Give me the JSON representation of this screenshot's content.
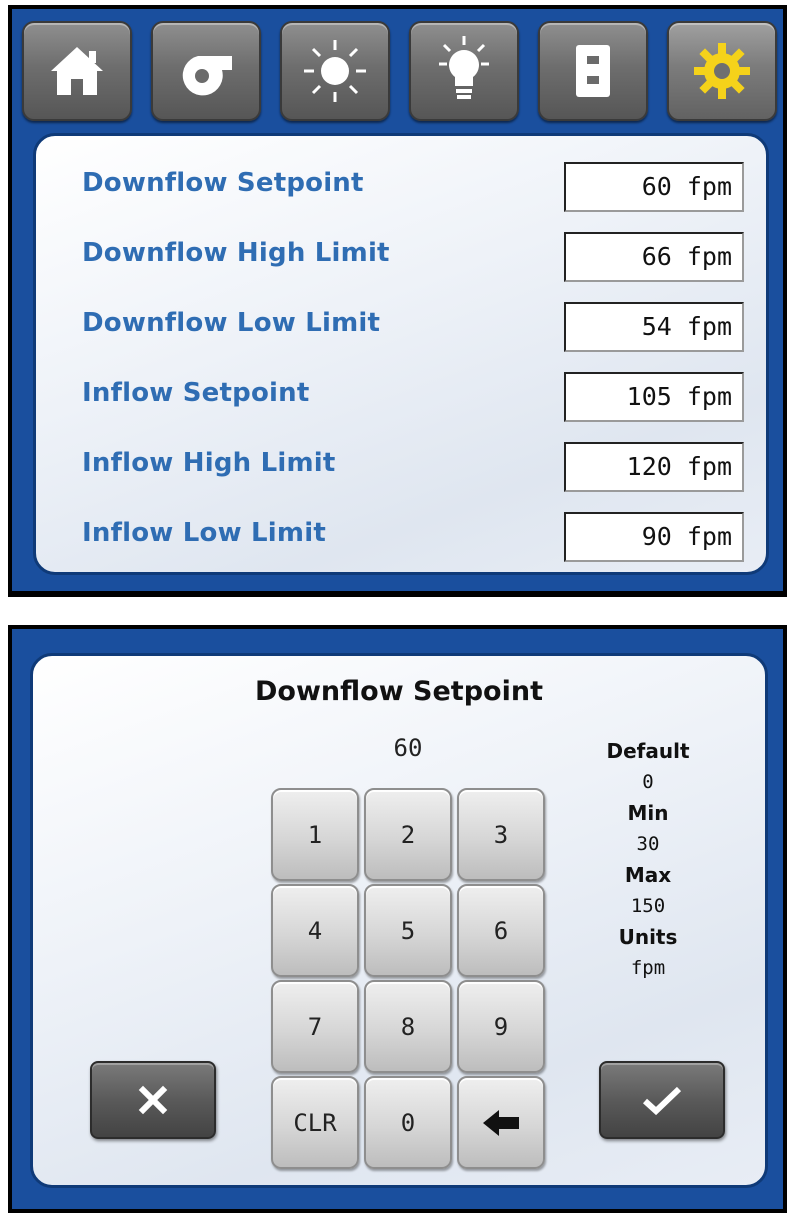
{
  "settings_screen": {
    "tabs": [
      {
        "icon": "home-icon",
        "active": false
      },
      {
        "icon": "fan-blower-icon",
        "active": false
      },
      {
        "icon": "sun-uv-icon",
        "active": false
      },
      {
        "icon": "light-bulb-icon",
        "active": false
      },
      {
        "icon": "outlet-icon",
        "active": false
      },
      {
        "icon": "gear-icon",
        "active": true
      }
    ],
    "rows": [
      {
        "label": "Downflow Setpoint",
        "value": "60 fpm"
      },
      {
        "label": "Downflow High Limit",
        "value": "66 fpm"
      },
      {
        "label": "Downflow Low Limit",
        "value": "54 fpm"
      },
      {
        "label": "Inflow Setpoint",
        "value": "105 fpm"
      },
      {
        "label": "Inflow High Limit",
        "value": "120 fpm"
      },
      {
        "label": "Inflow Low Limit",
        "value": "90 fpm"
      }
    ]
  },
  "keypad_screen": {
    "title": "Downflow Setpoint",
    "entry_value": "60",
    "keys": [
      "1",
      "2",
      "3",
      "4",
      "5",
      "6",
      "7",
      "8",
      "9",
      "CLR",
      "0",
      "backspace-icon"
    ],
    "info": {
      "default_label": "Default",
      "default_value": "0",
      "min_label": "Min",
      "min_value": "30",
      "max_label": "Max",
      "max_value": "150",
      "units_label": "Units",
      "units_value": "fpm"
    },
    "cancel_icon": "close-icon",
    "accept_icon": "check-icon"
  },
  "colors": {
    "frame_blue": "#1a4f9e",
    "label_blue": "#2f6db3",
    "gear_yellow": "#f5d21a"
  }
}
